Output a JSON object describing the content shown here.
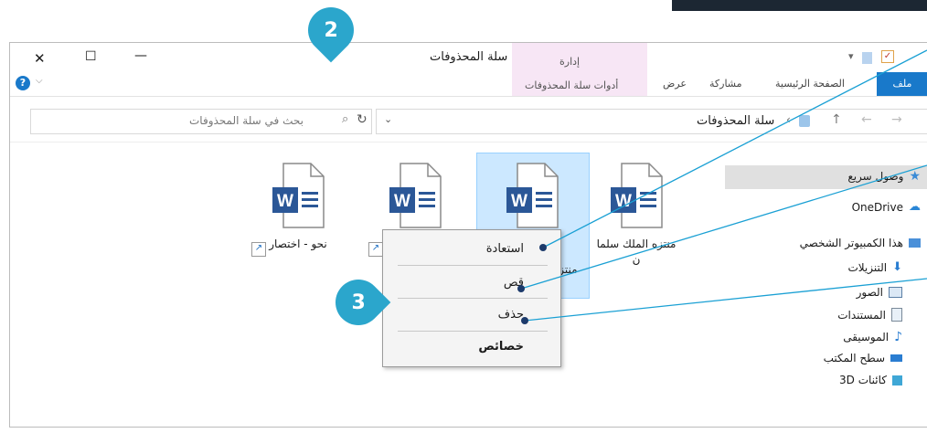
{
  "window": {
    "title": "سلة المحذوفات",
    "close_glyph": "✕",
    "maximize_glyph": "☐",
    "minimize_glyph": "—"
  },
  "ribbon": {
    "context_group": "إدارة",
    "context_tab": "أدوات سلة المحذوفات",
    "tabs": [
      "ملف",
      "الصفحة الرئيسية",
      "مشاركة",
      "عرض"
    ],
    "help_glyph": "?"
  },
  "address": {
    "path": "سلة المحذوفات",
    "search_placeholder": "بحث في سلة المحذوفات"
  },
  "nav": {
    "quick_access": "وصول سريع",
    "onedrive": "OneDrive",
    "this_pc": "هذا الكمبيوتر الشخصي",
    "items": [
      "التنزيلات",
      "الصور",
      "المستندات",
      "الموسيقى",
      "سطح المكتب",
      "كائنات 3D"
    ]
  },
  "files": [
    {
      "label_line1": "منتزه الملك سلما",
      "label_line2": "ن"
    },
    {
      "label_line1": "منتزه",
      "label_line2": ""
    },
    {
      "label_line1": "",
      "label_line2": ""
    },
    {
      "label_line1": "نحو - اختصار",
      "label_line2": ""
    }
  ],
  "context_menu": {
    "restore": "استعادة",
    "cut": "قص",
    "delete": "حذف",
    "properties": "خصائص"
  },
  "callouts": {
    "c2": "2",
    "c3": "3"
  },
  "colors": {
    "accent": "#1979ca",
    "callout": "#2ba6cc",
    "selection": "#cce8ff",
    "context_tab": "#f7e6f5",
    "word_blue": "#2b5797"
  }
}
